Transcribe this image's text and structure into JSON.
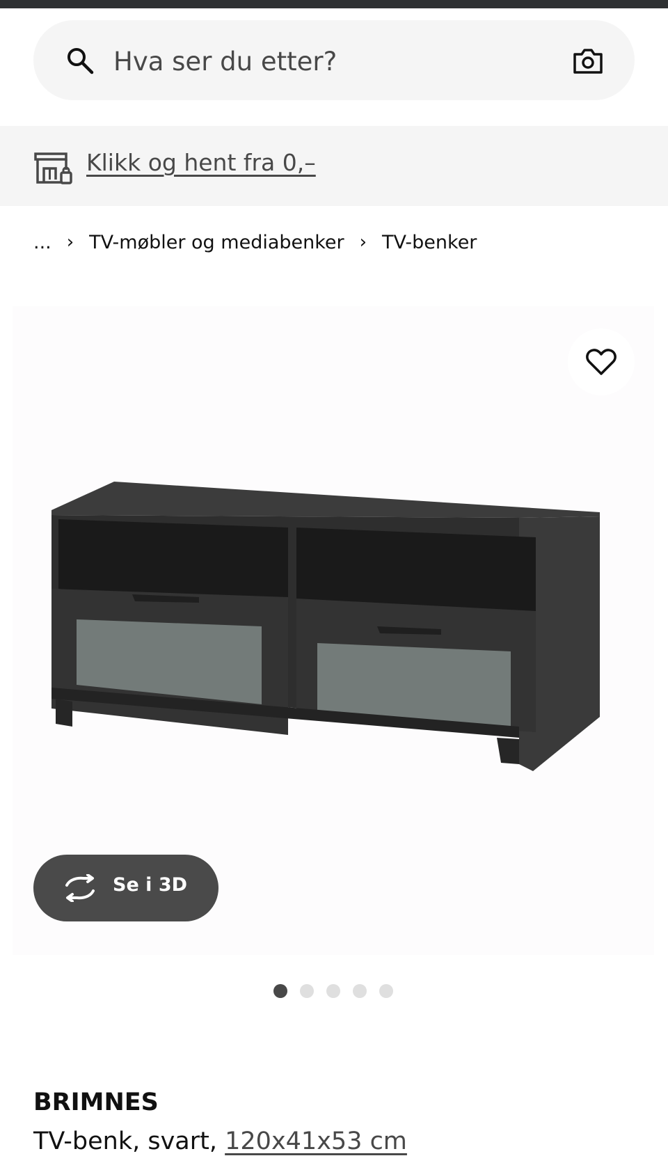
{
  "search": {
    "placeholder": "Hva ser du etter?"
  },
  "promo": {
    "text": "Klikk og hent fra 0,–"
  },
  "breadcrumb": {
    "ellipsis": "...",
    "items": [
      "TV-møbler og mediabenker",
      "TV-benker"
    ]
  },
  "gallery": {
    "view_3d_label": "Se i 3D",
    "dot_count": 5,
    "active_dot": 1
  },
  "product": {
    "name": "BRIMNES",
    "description": "TV-benk, svart,",
    "dimensions": "120x41x53 cm"
  },
  "colors": {
    "top_strip": "#2f3133",
    "surface_gray": "#f5f5f5",
    "button_dark": "#4a4a4a",
    "text_primary": "#111111",
    "text_secondary": "#484848",
    "dot_inactive": "#dfdfdf"
  },
  "icons": {
    "search": "search-icon",
    "camera": "camera-icon",
    "store": "store-icon",
    "favourite": "heart-icon",
    "view_3d": "rotate-icon"
  }
}
